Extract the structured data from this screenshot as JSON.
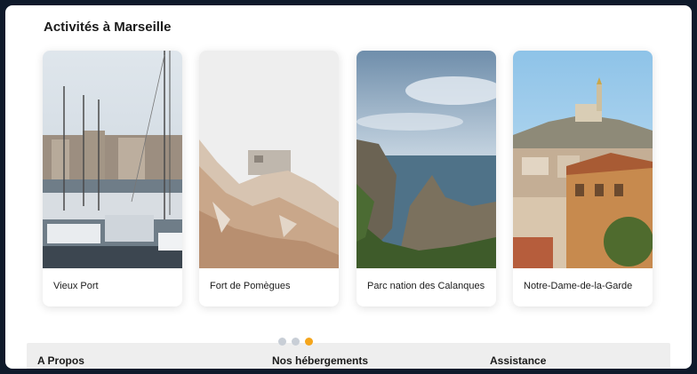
{
  "section": {
    "title": "Activités à Marseille"
  },
  "cards": [
    {
      "label": "Vieux Port"
    },
    {
      "label": "Fort de Pomègues"
    },
    {
      "label": "Parc nation des Calanques"
    },
    {
      "label": "Notre-Dame-de-la-Garde"
    }
  ],
  "carousel": {
    "total_pages": 3,
    "active_page": 3
  },
  "footer": {
    "columns": [
      {
        "label": "A Propos"
      },
      {
        "label": "Nos hébergements"
      },
      {
        "label": "Assistance"
      }
    ]
  },
  "colors": {
    "accent": "#f4a51c",
    "dot_inactive": "#c8ced6",
    "page_bg": "#0f1a2b"
  }
}
